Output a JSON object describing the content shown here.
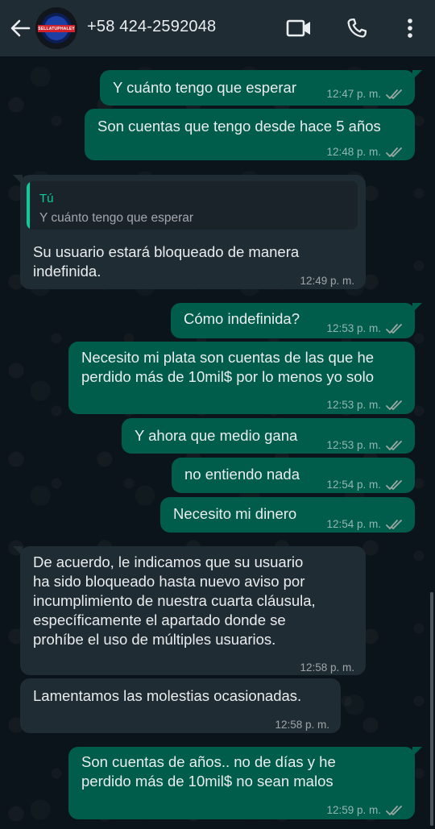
{
  "header": {
    "contact_name": "+58 424-2592048",
    "avatar_text": "SELLATUPHALEY",
    "icons": [
      "arrow-back-icon",
      "video-call-icon",
      "phone-call-icon",
      "more-vert-icon"
    ]
  },
  "colors": {
    "header_bg": "#1f2c34",
    "chat_bg": "#0b141a",
    "outgoing_bubble": "#005c4b",
    "incoming_bubble": "#202c33",
    "quote_accent": "#06cf9c",
    "read_ticks": "#9aa8a4"
  },
  "messages": [
    {
      "direction": "out",
      "text": "Y cuánto tengo que esperar",
      "time": "12:47 p. m.",
      "status": "read"
    },
    {
      "direction": "out",
      "text": "Son cuentas que tengo desde hace 5 años",
      "time": "12:48 p. m.",
      "status": "read"
    },
    {
      "direction": "in",
      "quote_author": "Tú",
      "quote_text": "Y cuánto tengo que esperar",
      "text": "Su usuario estará bloqueado de manera\nindefinida.",
      "time": "12:49 p. m."
    },
    {
      "direction": "out",
      "text": "Cómo indefinida?",
      "time": "12:53 p. m.",
      "status": "read"
    },
    {
      "direction": "out",
      "text": "Necesito mi plata son cuentas de las que he\nperdido más de 10mil$ por lo menos yo solo",
      "time": "12:53 p. m.",
      "status": "read"
    },
    {
      "direction": "out",
      "text": "Y ahora que medio gana",
      "time": "12:53 p. m.",
      "status": "read"
    },
    {
      "direction": "out",
      "text": "no entiendo nada",
      "time": "12:54 p. m.",
      "status": "read"
    },
    {
      "direction": "out",
      "text": "Necesito mi dinero",
      "time": "12:54 p. m.",
      "status": "read"
    },
    {
      "direction": "in",
      "text": "De acuerdo, le indicamos que su usuario\nha sido bloqueado hasta nuevo aviso por\nincumplimiento de nuestra cuarta cláusula,\nespecíficamente el apartado donde se\nprohíbe el uso de múltiples usuarios.",
      "time": "12:58 p. m."
    },
    {
      "direction": "in",
      "text": "Lamentamos las molestias ocasionadas.",
      "time": "12:58 p. m."
    },
    {
      "direction": "out",
      "text": "Son cuentas de años.. no de días y he\nperdido más de 10mil$ no sean malos",
      "time": "12:59 p. m.",
      "status": "read"
    }
  ]
}
